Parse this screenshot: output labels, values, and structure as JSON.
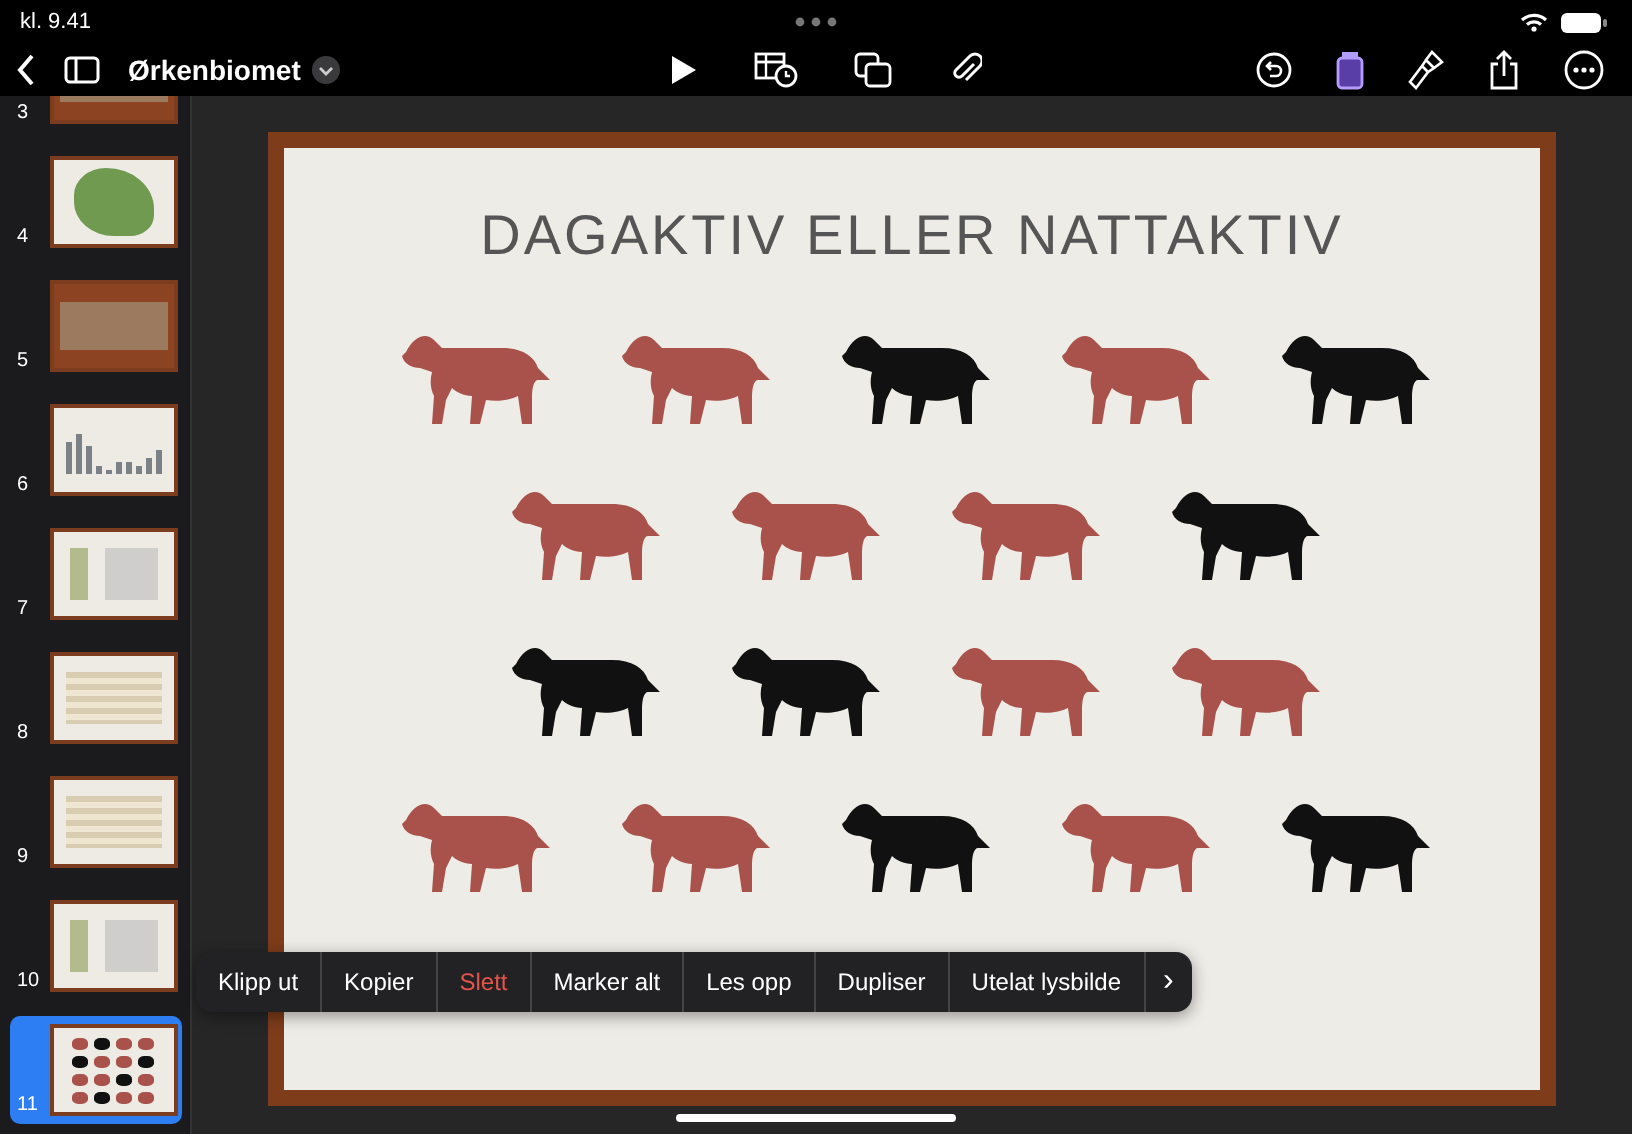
{
  "status_bar": {
    "time": "kl. 9.41"
  },
  "toolbar": {
    "document_title": "Ørkenbiomet"
  },
  "slides": [
    {
      "number": "3",
      "kind": "photo",
      "selected": false
    },
    {
      "number": "4",
      "kind": "map",
      "selected": false
    },
    {
      "number": "5",
      "kind": "photo",
      "selected": false
    },
    {
      "number": "6",
      "kind": "chart",
      "selected": false
    },
    {
      "number": "7",
      "kind": "plain",
      "selected": false
    },
    {
      "number": "8",
      "kind": "table",
      "selected": false
    },
    {
      "number": "9",
      "kind": "table",
      "selected": false
    },
    {
      "number": "10",
      "kind": "plain",
      "selected": false
    },
    {
      "number": "11",
      "kind": "animals",
      "selected": true
    }
  ],
  "slide": {
    "title": "DAGAKTIV ELLER NATTAKTIV",
    "animal_rows": [
      [
        {
          "color": "#a9524b"
        },
        {
          "color": "#a9524b"
        },
        {
          "color": "#111111"
        },
        {
          "color": "#a9524b"
        },
        {
          "color": "#111111"
        }
      ],
      [
        {
          "color": "#a9524b"
        },
        {
          "color": "#a9524b"
        },
        {
          "color": "#a9524b"
        },
        {
          "color": "#111111"
        }
      ],
      [
        {
          "color": "#111111"
        },
        {
          "color": "#111111"
        },
        {
          "color": "#a9524b"
        },
        {
          "color": "#a9524b"
        }
      ],
      [
        {
          "color": "#a9524b"
        },
        {
          "color": "#a9524b"
        },
        {
          "color": "#111111"
        },
        {
          "color": "#a9524b"
        },
        {
          "color": "#111111"
        }
      ]
    ]
  },
  "context_menu": {
    "items": [
      {
        "label": "Klipp ut",
        "destructive": false
      },
      {
        "label": "Kopier",
        "destructive": false
      },
      {
        "label": "Slett",
        "destructive": true
      },
      {
        "label": "Marker alt",
        "destructive": false
      },
      {
        "label": "Les opp",
        "destructive": false
      },
      {
        "label": "Dupliser",
        "destructive": false
      },
      {
        "label": "Utelat lysbilde",
        "destructive": false
      }
    ],
    "more": "›"
  }
}
